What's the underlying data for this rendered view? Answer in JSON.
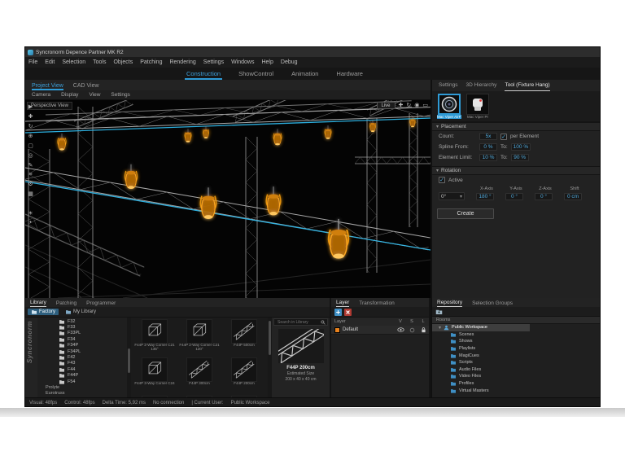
{
  "window": {
    "title": "Syncronorm Depence Partner MK R2"
  },
  "menu": {
    "items": [
      "File",
      "Edit",
      "Selection",
      "Tools",
      "Objects",
      "Patching",
      "Rendering",
      "Settings",
      "Windows",
      "Help",
      "Debug"
    ]
  },
  "workspace_tabs": {
    "construction": "Construction",
    "showcontrol": "ShowControl",
    "animation": "Animation",
    "hardware": "Hardware"
  },
  "view_panel": {
    "tab_project": "Project View",
    "tab_cad": "CAD View",
    "subtabs": [
      "Camera",
      "Display",
      "View",
      "Settings"
    ],
    "viewport_label": "Perspective View",
    "live": "Live"
  },
  "icons": {
    "select": "▶",
    "move": "✚",
    "orbit": "↻",
    "add": "⊕",
    "box": "▢",
    "camera": "◎",
    "draw": "✎",
    "measure": "≡",
    "gear": "⚙",
    "grid": "▦",
    "sun": "☀",
    "dot": "•",
    "pan": "✚",
    "rotate": "↻",
    "lamp": "◉",
    "display": "▭",
    "chevron_down": "▾",
    "section_down": "▾"
  },
  "tool_panel": {
    "tab_settings": "Settings",
    "tab_hierarchy": "3D Hierarchy",
    "tab_tool": "Tool (Fixture Hang)",
    "fixture1": "Mac Viper AirFX",
    "fixture2": "Mac Viper Pr",
    "placement": {
      "title": "Placement",
      "count_label": "Count:",
      "count_value": "5x",
      "per_element_label": "per Element",
      "spline_label": "Spline From:",
      "spline_from": "0 %",
      "to_label": "To:",
      "spline_to": "100 %",
      "limit_label": "Element Limit:",
      "limit_from": "10 %",
      "to_label2": "To:",
      "limit_to": "90 %"
    },
    "rotation": {
      "title": "Rotation",
      "active_label": "Active",
      "preset": "0°",
      "col_x": "X-Axis",
      "col_y": "Y-Axis",
      "col_z": "Z-Axis",
      "col_shift": "Shift",
      "val_x": "180 °",
      "val_y": "0 °",
      "val_z": "0 °",
      "val_shift": "0 cm"
    },
    "create_label": "Create",
    "check_glyph": "✓"
  },
  "library_panel": {
    "tab_library": "Library",
    "tab_patching": "Patching",
    "tab_programmer": "Programmer",
    "source_factory": "Factory",
    "source_mylibrary": "My Library",
    "logo": "Syncronorm",
    "tree": [
      "F32",
      "F33",
      "F33PL",
      "F34",
      "F34P",
      "F34PL",
      "F42",
      "F43",
      "F44",
      "F44P",
      "F54"
    ],
    "tree_categories": [
      "Prolyte",
      "Eurotruss"
    ],
    "search_placeholder": "Search in Library",
    "grid": [
      {
        "label": "F44P 2-Way Corner C21 135°"
      },
      {
        "label": "F44P 2-Way Corner C21 120°"
      },
      {
        "label": "F44P 500cm"
      },
      {
        "label": "F44P 3-Way Corner C24"
      },
      {
        "label": "F44P 300cm"
      },
      {
        "label": "F44P 200cm"
      },
      {
        "label": ""
      },
      {
        "label": ""
      },
      {
        "label": ""
      }
    ],
    "preview": {
      "name": "F44P 200cm",
      "size_label": "Estimated Size",
      "size_value": "200 x 40 x 40 cm"
    }
  },
  "layer_panel": {
    "tab_layer": "Layer",
    "tab_transformation": "Transformation",
    "col_layer": "Layer",
    "col_v": "V",
    "col_s": "S",
    "col_l": "L",
    "row_name": "Default",
    "row_color": "#e8821e"
  },
  "repo_panel": {
    "tab_repository": "Repository",
    "tab_groups": "Selection Groups",
    "rooms_label": "Rooms",
    "root": "Public Workspace",
    "children": [
      "Scenes",
      "Shows",
      "Playlists",
      "MagiCues",
      "Scripts",
      "Audio Files",
      "Video Files",
      "Profiles",
      "Virtual Masters"
    ]
  },
  "status_bar": {
    "items": [
      "Visual: 48fps",
      "Control: 48fps",
      "Delta Time: 5,92 ms",
      "No connection",
      "| Current User:",
      "Public Workspace"
    ]
  },
  "colors": {
    "accent": "#2f9bd6",
    "value_blue": "#4fa8da",
    "fixture_orange": "#f0970f",
    "spline_cyan": "#2fb7e8"
  }
}
